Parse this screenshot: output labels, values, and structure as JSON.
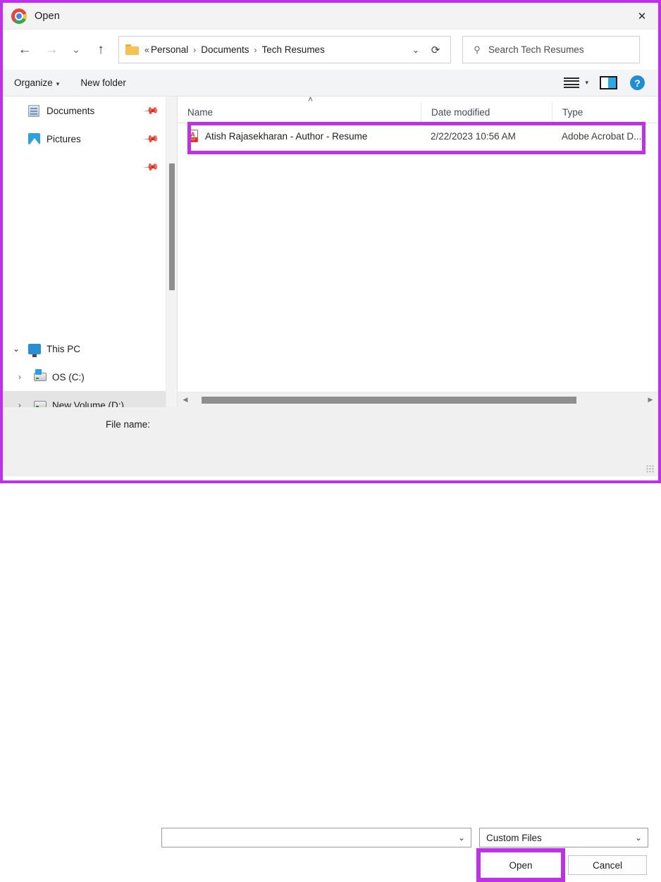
{
  "window": {
    "title": "Open",
    "app_icon": "chrome-icon",
    "close_label": "✕",
    "annotation_color": "#bf31e8"
  },
  "nav": {
    "back": "←",
    "forward": "→",
    "recent": "⌄",
    "up": "↑"
  },
  "address": {
    "folder_icon": "folder-icon",
    "leading_chevrons": "«",
    "crumbs": [
      "Personal",
      "Documents",
      "Tech Resumes"
    ],
    "separator": "›",
    "dropdown": "⌄",
    "refresh": "⟳"
  },
  "search": {
    "icon": "⚲",
    "placeholder": "Search Tech Resumes"
  },
  "command_bar": {
    "organize_label": "Organize",
    "organize_caret": "▾",
    "new_folder_label": "New folder",
    "view_caret": "▾",
    "help_label": "?"
  },
  "sidebar": {
    "items": [
      {
        "label": "Documents",
        "icon": "documents-icon",
        "pinned": true,
        "selected": false,
        "expander": ""
      },
      {
        "label": "Pictures",
        "icon": "pictures-icon",
        "pinned": true,
        "selected": false,
        "expander": ""
      },
      {
        "label": "This PC",
        "icon": "this-pc-icon",
        "pinned": false,
        "selected": false,
        "expander": "⌄"
      },
      {
        "label": "OS (C:)",
        "icon": "drive-icon",
        "pinned": false,
        "selected": false,
        "expander": "›"
      },
      {
        "label": "New Volume (D:)",
        "icon": "drive-icon",
        "pinned": false,
        "selected": true,
        "expander": "›"
      }
    ],
    "pin_glyph": "📌"
  },
  "file_list": {
    "sort_caret": "˄",
    "columns": [
      "Name",
      "Date modified",
      "Type"
    ],
    "rows": [
      {
        "name": "Atish Rajasekharan - Author - Resume",
        "date_modified": "2/22/2023 10:56 AM",
        "type": "Adobe Acrobat D...",
        "icon": "pdf-icon",
        "icon_glyph": "A",
        "icon_tag": "PDF",
        "highlighted": true
      }
    ],
    "hscroll_left": "◀",
    "hscroll_right": "▶"
  },
  "footer": {
    "filename_label": "File name:",
    "filename_value": "",
    "filename_placeholder": "",
    "filetype_value": "Custom Files",
    "dropdown_caret": "⌄",
    "open_label": "Open",
    "cancel_label": "Cancel"
  }
}
